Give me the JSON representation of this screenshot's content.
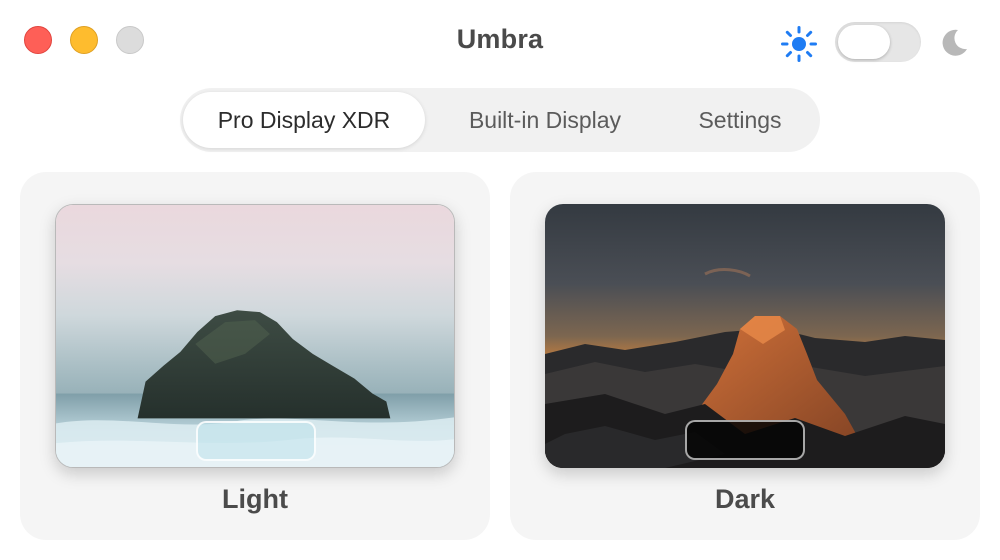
{
  "window": {
    "title": "Umbra",
    "traffic_lights": [
      {
        "name": "close",
        "color": "#fe5f57"
      },
      {
        "name": "minimize",
        "color": "#febc2e"
      },
      {
        "name": "zoom",
        "color": "#dcdcdc"
      }
    ]
  },
  "appearance_toggle": {
    "left_icon": "sun-icon",
    "right_icon": "moon-icon",
    "state": "off",
    "sun_color": "#1f7cf3",
    "moon_color": "#b8b8b8"
  },
  "tabs": [
    {
      "label": "Pro Display XDR",
      "active": true
    },
    {
      "label": "Built-in Display",
      "active": false
    },
    {
      "label": "Settings",
      "active": false
    }
  ],
  "cards": {
    "light": {
      "label": "Light",
      "wallpaper": "sea-stack-in-mist"
    },
    "dark": {
      "label": "Dark",
      "wallpaper": "half-dome-sunset"
    }
  }
}
